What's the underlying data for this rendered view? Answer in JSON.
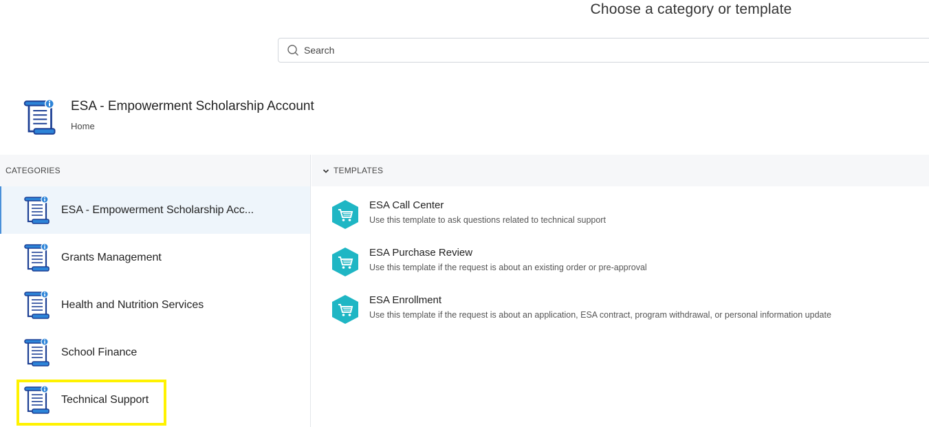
{
  "page": {
    "title": "Choose a category or template"
  },
  "search": {
    "placeholder": "Search"
  },
  "portal": {
    "title": "ESA - Empowerment Scholarship Account",
    "breadcrumb": "Home"
  },
  "categories": {
    "header": "CATEGORIES",
    "items": [
      {
        "label": "ESA - Empowerment Scholarship Acc...",
        "icon": "document-scroll-icon"
      },
      {
        "label": "Grants Management",
        "icon": "document-scroll-icon"
      },
      {
        "label": "Health and Nutrition Services",
        "icon": "document-scroll-icon"
      },
      {
        "label": "School Finance",
        "icon": "document-scroll-icon"
      },
      {
        "label": "Technical Support",
        "icon": "document-scroll-icon"
      }
    ]
  },
  "templates": {
    "header": "TEMPLATES",
    "items": [
      {
        "name": "ESA Call Center",
        "description": "Use this template to ask questions related to technical support",
        "icon": "cart-icon"
      },
      {
        "name": "ESA Purchase Review",
        "description": "Use this template if the request is about an existing order or pre-approval",
        "icon": "cart-icon"
      },
      {
        "name": "ESA Enrollment",
        "description": "Use this template if the request is about an application, ESA contract, program withdrawal, or personal information update",
        "icon": "cart-icon"
      }
    ]
  },
  "colors": {
    "accent": "#4a90d9",
    "template_icon": "#1fb6c4",
    "highlight": "#fff200",
    "active_bg": "#eef5fb"
  }
}
